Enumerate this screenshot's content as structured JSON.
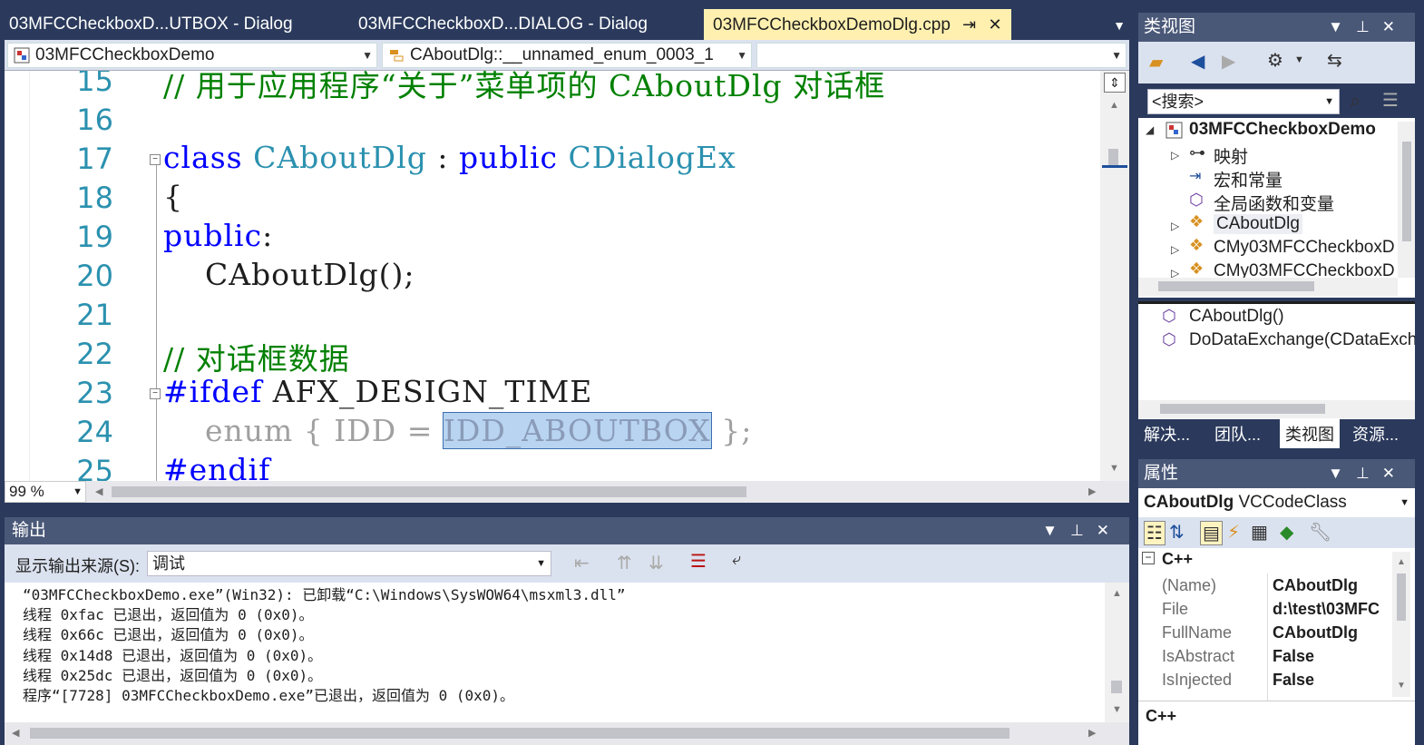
{
  "tabs": [
    {
      "label": "03MFCCheckboxD...UTBOX - Dialog",
      "active": false
    },
    {
      "label": "03MFCCheckboxD...DIALOG - Dialog",
      "active": false
    },
    {
      "label": "03MFCCheckboxDemoDlg.cpp",
      "active": true
    }
  ],
  "navbar": {
    "project": "03MFCCheckboxDemo",
    "scope": "CAboutDlg::__unnamed_enum_0003_1",
    "member": ""
  },
  "editor": {
    "lines": [
      {
        "num": "15",
        "text": "// 用于应用程序“关于”菜单项的 CAboutDlg 对话框"
      },
      {
        "num": "16",
        "text": ""
      },
      {
        "num": "17",
        "kw": "class",
        "type1": "CAboutDlg",
        "sep": " : ",
        "kw2": "public",
        "type2": "CDialogEx"
      },
      {
        "num": "18",
        "text": "{"
      },
      {
        "num": "19",
        "kw": "public",
        "rest": ":"
      },
      {
        "num": "20",
        "text": "    CAboutDlg();"
      },
      {
        "num": "21",
        "text": ""
      },
      {
        "num": "22",
        "text": "// 对话框数据"
      },
      {
        "num": "23",
        "pp": "#ifdef",
        "rest": " AFX_DESIGN_TIME"
      },
      {
        "num": "24",
        "kw": "enum",
        "pre": " { IDD = ",
        "sel": "IDD_ABOUTBOX",
        "post": " };"
      },
      {
        "num": "25",
        "pp": "#endif"
      }
    ],
    "zoom": "99 %"
  },
  "output": {
    "title": "输出",
    "source_label": "显示输出来源(S):",
    "source_value": "调试",
    "lines": [
      "“03MFCCheckboxDemo.exe”(Win32): 已卸载“C:\\Windows\\SysWOW64\\msxml3.dll”",
      "线程 0xfac 已退出，返回值为 0 (0x0)。",
      "线程 0x66c 已退出，返回值为 0 (0x0)。",
      "线程 0x14d8 已退出，返回值为 0 (0x0)。",
      "线程 0x25dc 已退出，返回值为 0 (0x0)。",
      "程序“[7728] 03MFCCheckboxDemo.exe”已退出，返回值为 0 (0x0)。"
    ]
  },
  "classview": {
    "title": "类视图",
    "search_placeholder": "<搜索>",
    "tree": [
      {
        "label": "03MFCCheckboxDemo",
        "bold": true
      },
      {
        "label": "映射"
      },
      {
        "label": "宏和常量"
      },
      {
        "label": "全局函数和变量"
      },
      {
        "label": "CAboutDlg"
      },
      {
        "label": "CMy03MFCCheckboxD"
      },
      {
        "label": "CMy03MFCCheckboxD"
      }
    ],
    "members": [
      {
        "label": "CAboutDlg()"
      },
      {
        "label": "DoDataExchange(CDataExch"
      }
    ],
    "bottom_tabs": [
      {
        "label": "解决...",
        "active": false
      },
      {
        "label": "团队...",
        "active": false
      },
      {
        "label": "类视图",
        "active": true
      },
      {
        "label": "资源...",
        "active": false
      }
    ]
  },
  "properties": {
    "title": "属性",
    "object_name": "CAboutDlg",
    "object_type": "VCCodeClass",
    "category": "C++",
    "rows": [
      {
        "name": "(Name)",
        "value": "CAboutDlg"
      },
      {
        "name": "File",
        "value": "d:\\test\\03MFC"
      },
      {
        "name": "FullName",
        "value": "CAboutDlg"
      },
      {
        "name": "IsAbstract",
        "value": "False"
      },
      {
        "name": "IsInjected",
        "value": "False"
      }
    ],
    "description": "C++"
  }
}
